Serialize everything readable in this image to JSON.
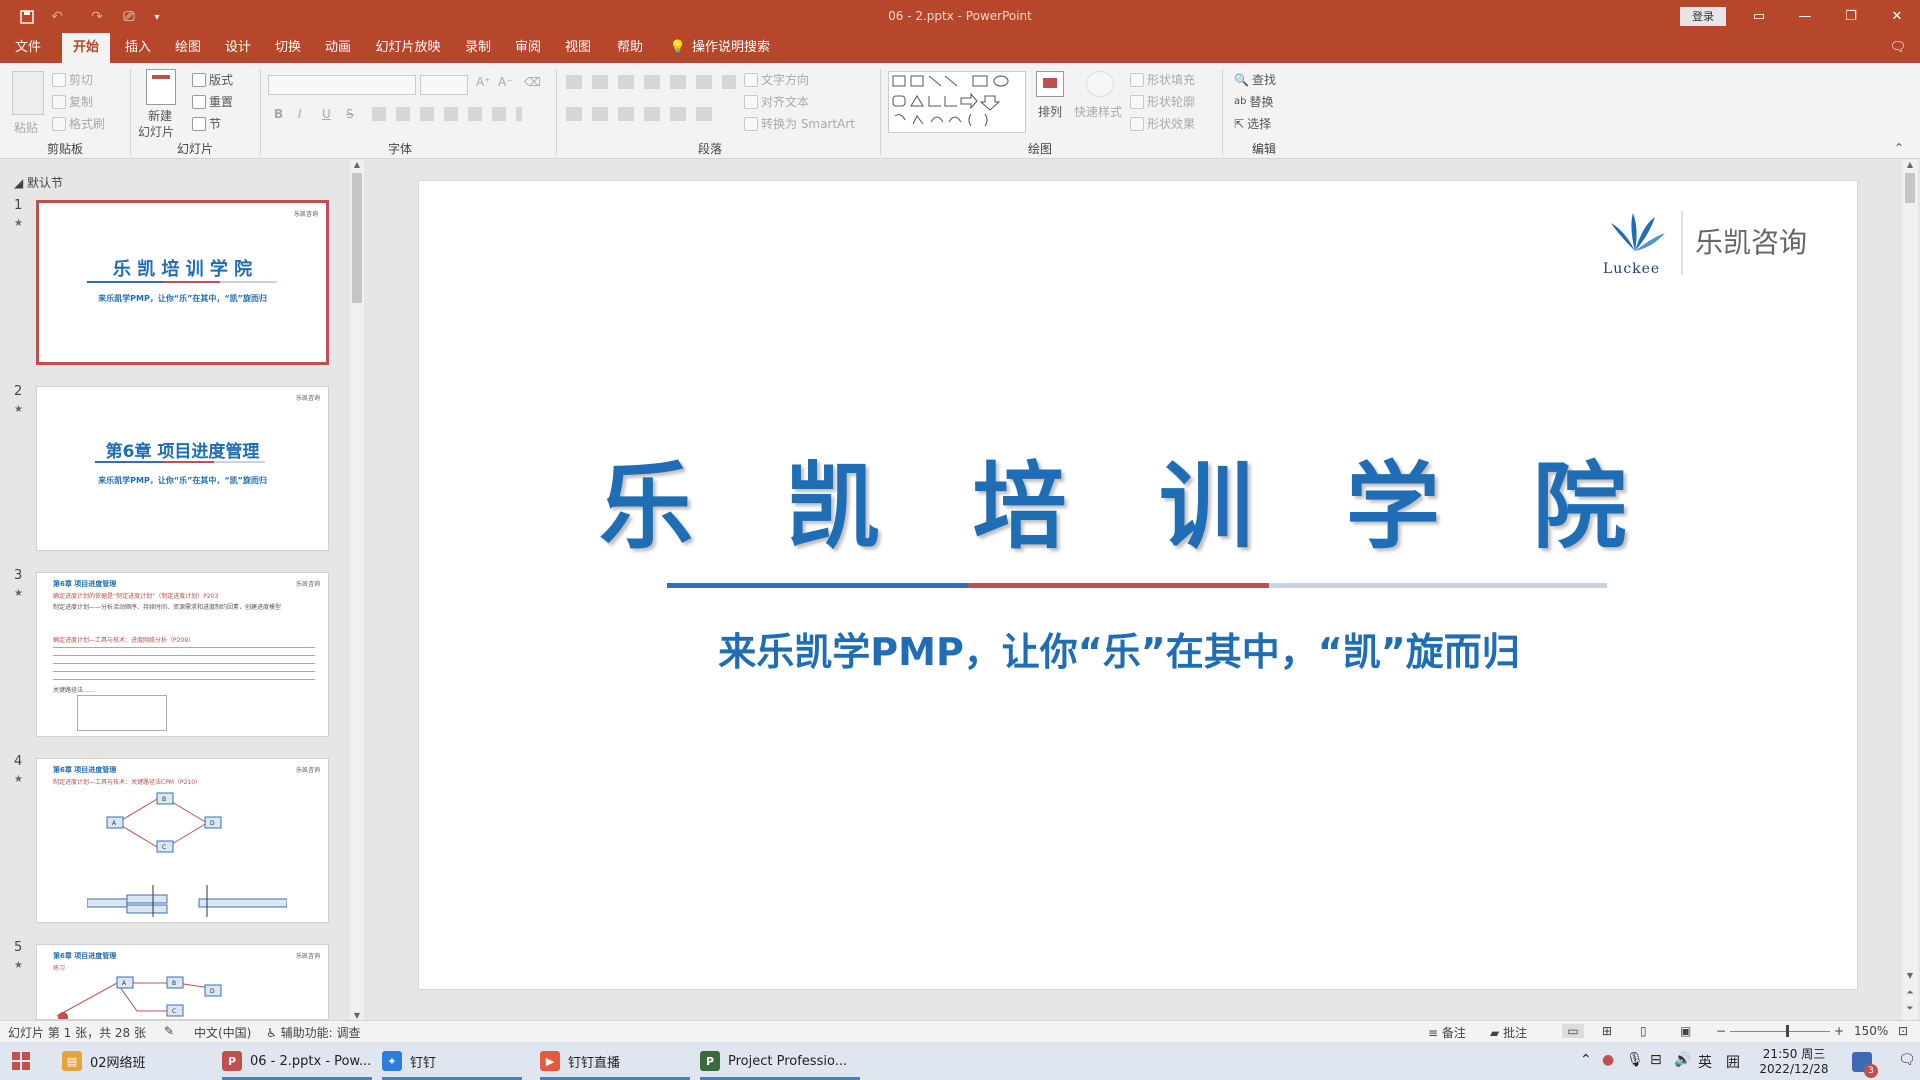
{
  "titlebar": {
    "title": "06 - 2.pptx  -  PowerPoint",
    "login": "登录"
  },
  "tabs": [
    "文件",
    "开始",
    "插入",
    "绘图",
    "设计",
    "切换",
    "动画",
    "幻灯片放映",
    "录制",
    "审阅",
    "视图",
    "帮助"
  ],
  "tell_me": "操作说明搜索",
  "ribbon": {
    "clipboard": {
      "paste": "粘贴",
      "cut": "剪切",
      "copy": "复制",
      "format_painter": "格式刷",
      "label": "剪贴板"
    },
    "slides": {
      "new_slide": "新建",
      "new_slide2": "幻灯片",
      "layout": "版式",
      "reset": "重置",
      "section": "节",
      "label": "幻灯片"
    },
    "font": {
      "bold": "B",
      "italic": "I",
      "underline": "U",
      "strike": "S",
      "label": "字体"
    },
    "paragraph": {
      "text_direction": "文字方向",
      "align_text": "对齐文本",
      "smartart": "转换为 SmartArt",
      "label": "段落"
    },
    "drawing": {
      "arrange": "排列",
      "quick_styles": "快速样式",
      "fill": "形状填充",
      "outline": "形状轮廓",
      "effects": "形状效果",
      "label": "绘图"
    },
    "editing": {
      "find": "查找",
      "replace": "替换",
      "select": "选择",
      "label": "编辑"
    }
  },
  "panel": {
    "section": "默认节"
  },
  "thumbs": [
    {
      "num": "1",
      "title": "乐 凯 培 训 学 院",
      "sub": "来乐凯学PMP，让你“乐”在其中，“凯”旋而归",
      "logo": "乐凯咨询"
    },
    {
      "num": "2",
      "title": "第6章  项目进度管理",
      "sub": "来乐凯学PMP，让你“乐”在其中，“凯”旋而归",
      "logo": "乐凯咨询"
    },
    {
      "num": "3",
      "heading": "第6章 项目进度管理",
      "l1": "确定进度计划的依据是“制定进度计划”（制定进度计划）P203",
      "l2": "制定进度计划——分析活动顺序、持续时间、资源需求和进度制约因素，创建进度模型",
      "l3": "确定进度计划—工具与技术：进度网络分析（P209）",
      "l4": "关键路径法……",
      "logo": "乐凯咨询"
    },
    {
      "num": "4",
      "heading": "第6章 项目进度管理",
      "l1": "制定进度计划—工具与技术：关键路径法CPM（P210）",
      "nodes": [
        "A",
        "B",
        "C",
        "D"
      ],
      "logo": "乐凯咨询"
    },
    {
      "num": "5",
      "heading": "第6章 项目进度管理",
      "l1": "练习",
      "nodes": [
        "A",
        "B",
        "C",
        "D"
      ],
      "logo": "乐凯咨询"
    }
  ],
  "slide": {
    "title": "乐 凯 培 训 学 院",
    "subtitle": "来乐凯学PMP，让你“乐”在其中，“凯”旋而归",
    "logo_text": "乐凯咨询",
    "logo_en": "Luckee",
    "colors": {
      "title": "#1f6db5",
      "line_blue": "#2e6fb8",
      "line_red": "#c0504d",
      "line_gray": "#c9d3df"
    }
  },
  "status": {
    "slide_info": "幻灯片 第 1 张，共 28 张",
    "lang": "中文(中国)",
    "access": "辅助功能: 调查",
    "notes": "备注",
    "comments": "批注",
    "zoom": "150%"
  },
  "taskbar": {
    "apps": [
      "02网络班",
      "06 - 2.pptx - Pow...",
      "钉钉",
      "钉钉直播",
      "Project Professio..."
    ],
    "ime": "英",
    "time": "21:50 周三",
    "date": "2022/12/28",
    "badge": "3"
  }
}
